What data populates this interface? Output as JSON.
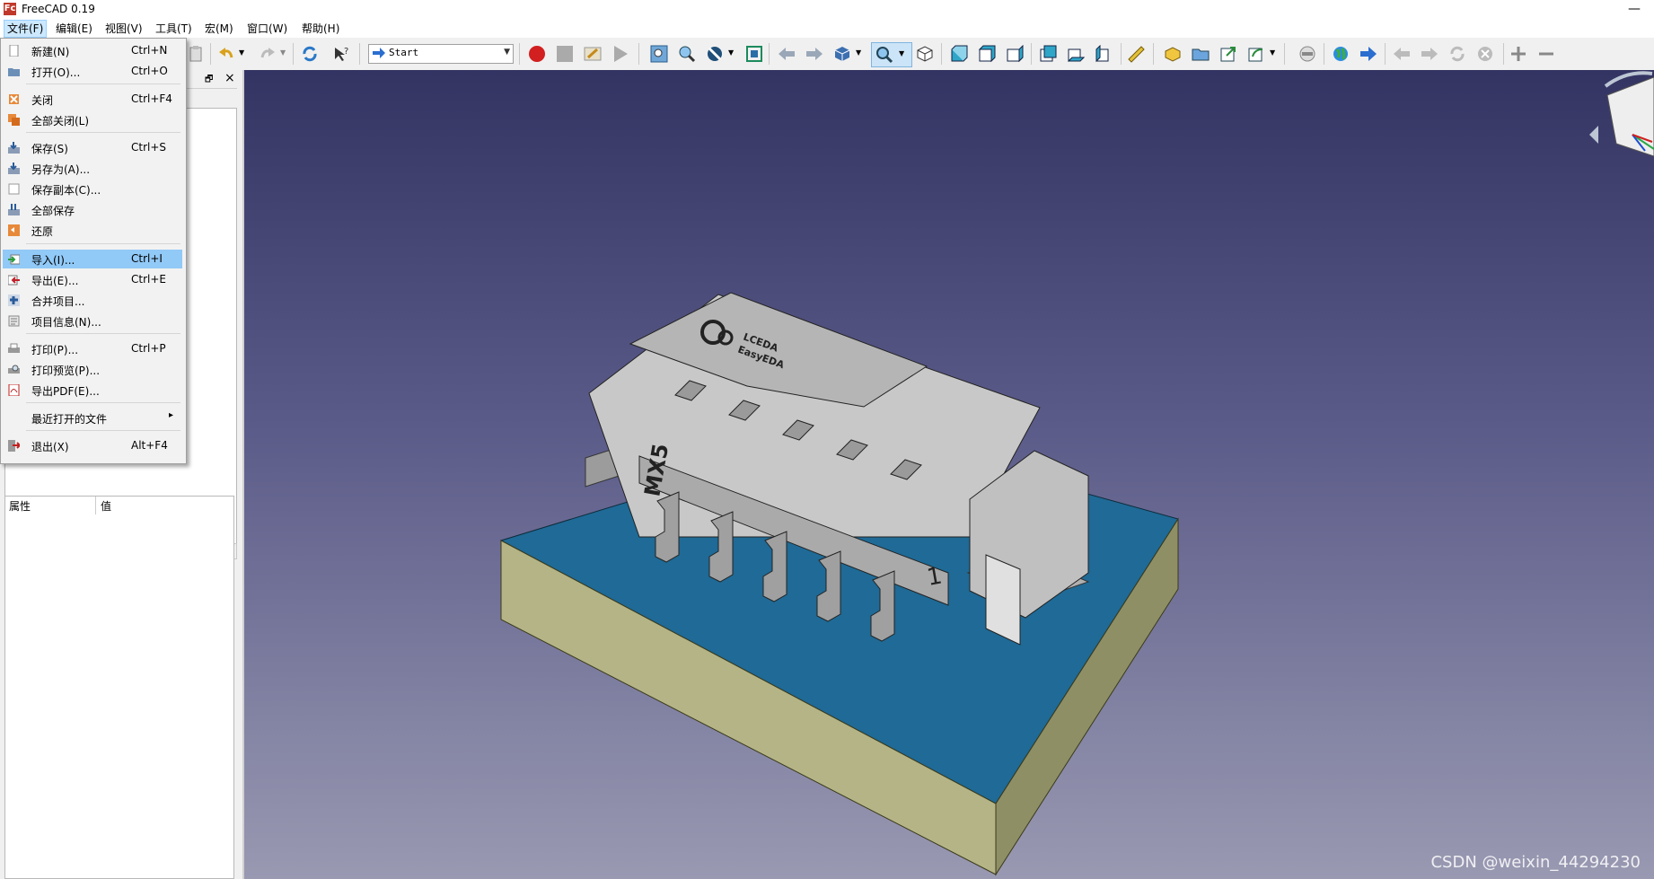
{
  "window": {
    "title": "FreeCAD 0.19",
    "logo": "Fc",
    "minimize": "—"
  },
  "menubar": [
    "文件(F)",
    "编辑(E)",
    "视图(V)",
    "工具(T)",
    "宏(M)",
    "窗口(W)",
    "帮助(H)"
  ],
  "toolbar": {
    "workbench": "Start"
  },
  "file_menu": {
    "items": [
      {
        "label": "新建(N)",
        "shortcut": "Ctrl+N",
        "icon": "new-document-icon"
      },
      {
        "label": "打开(O)...",
        "shortcut": "Ctrl+O",
        "icon": "open-folder-icon"
      },
      {
        "label": "关闭",
        "shortcut": "Ctrl+F4",
        "icon": "close-icon"
      },
      {
        "label": "全部关闭(L)",
        "shortcut": "",
        "icon": "close-all-icon"
      },
      {
        "label": "保存(S)",
        "shortcut": "Ctrl+S",
        "icon": "save-icon"
      },
      {
        "label": "另存为(A)...",
        "shortcut": "",
        "icon": "save-as-icon"
      },
      {
        "label": "保存副本(C)...",
        "shortcut": "",
        "icon": "save-copy-icon"
      },
      {
        "label": "全部保存",
        "shortcut": "",
        "icon": "save-all-icon"
      },
      {
        "label": "还原",
        "shortcut": "",
        "icon": "revert-icon"
      },
      {
        "label": "导入(I)...",
        "shortcut": "Ctrl+I",
        "icon": "import-icon"
      },
      {
        "label": "导出(E)...",
        "shortcut": "Ctrl+E",
        "icon": "export-icon"
      },
      {
        "label": "合并项目...",
        "shortcut": "",
        "icon": "merge-icon"
      },
      {
        "label": "项目信息(N)...",
        "shortcut": "",
        "icon": "project-info-icon"
      },
      {
        "label": "打印(P)...",
        "shortcut": "Ctrl+P",
        "icon": "print-icon"
      },
      {
        "label": "打印预览(P)...",
        "shortcut": "",
        "icon": "print-preview-icon"
      },
      {
        "label": "导出PDF(E)...",
        "shortcut": "",
        "icon": "pdf-icon"
      },
      {
        "label": "最近打开的文件",
        "shortcut": "",
        "icon": "",
        "submenu": "▸"
      },
      {
        "label": "退出(X)",
        "shortcut": "Alt+F4",
        "icon": "exit-icon"
      }
    ]
  },
  "property_view": {
    "col_property": "属性",
    "col_value": "值"
  },
  "model": {
    "marking_text": "MX5",
    "pin_one": "1",
    "brand_line1": "LCEDA",
    "brand_line2": "EasyEDA"
  },
  "watermark": "CSDN @weixin_44294230",
  "colors": {
    "board_top": "#1f6a96",
    "board_side": "#b4b486",
    "connector": "#c8c8c8",
    "highlight": "#91c9f7"
  }
}
